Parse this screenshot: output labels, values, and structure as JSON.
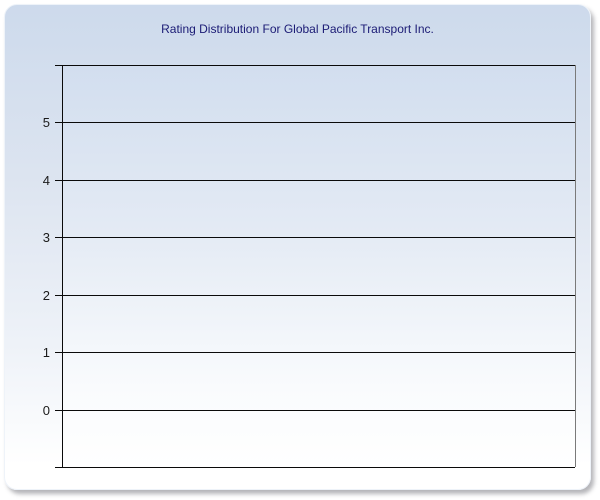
{
  "panel": {
    "background_top": "#cddaec",
    "background_bottom": "#ffffff"
  },
  "chart_data": {
    "type": "bar",
    "title": "Rating Distribution For Global Pacific Transport Inc.",
    "categories": [],
    "series": [],
    "xlabel": "",
    "ylabel": "",
    "ylim": [
      -1,
      6
    ],
    "y_ticks": [
      5,
      4,
      3,
      2,
      1,
      0
    ],
    "grid": "horizontal",
    "legend": "none",
    "colors": {
      "title_text": "#1b1b75",
      "axis_and_gridline": "#0a0a0a",
      "tick_label_text": "#1a1a1a",
      "plot_bg_top": "#d2deef",
      "plot_bg_bottom": "#ffffff",
      "plot_right_border": "#7a7a7a"
    }
  }
}
